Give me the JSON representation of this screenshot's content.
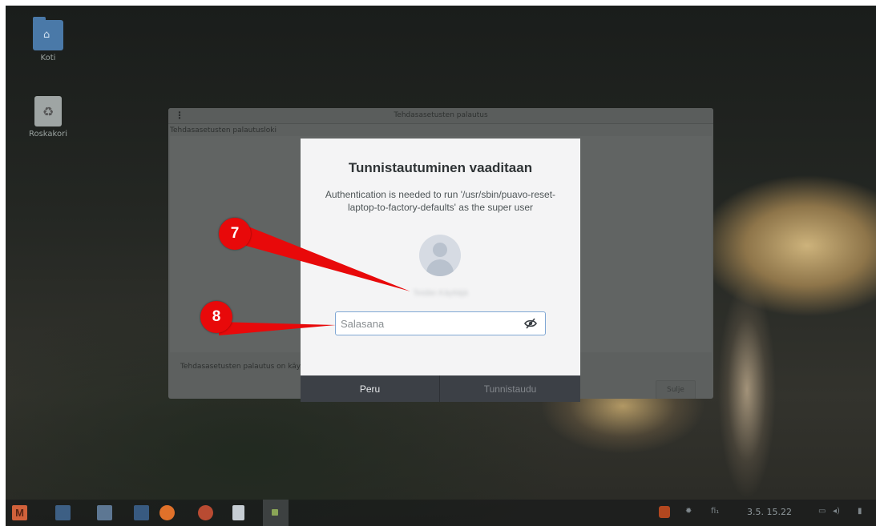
{
  "desktop": {
    "icons": [
      {
        "label": "Koti",
        "icon": "home-folder-icon"
      },
      {
        "label": "Roskakori",
        "icon": "trash-icon"
      }
    ]
  },
  "reset_window": {
    "menu_glyph": "⋮",
    "title": "Tehdasasetusten palautus",
    "log_label": "Tehdasasetusten palautusloki",
    "status_text": "Tehdasasetusten palautus on käy",
    "close_label": "Sulje"
  },
  "auth_dialog": {
    "heading": "Tunnistautuminen vaaditaan",
    "message": "Authentication is needed to run '/usr/sbin/puavo-reset-laptop-to-factory-defaults' as the super user",
    "username": "Teidän Käyttäjä",
    "password_placeholder": "Salasana",
    "password_value": "",
    "cancel_label": "Peru",
    "authenticate_label": "Tunnistaudu"
  },
  "annotations": [
    {
      "number": "7",
      "target": "username"
    },
    {
      "number": "8",
      "target": "password-field"
    }
  ],
  "taskbar": {
    "menu_label": "M",
    "keyboard_layout": "fi₁",
    "clock": "3.5. 15.22"
  },
  "colors": {
    "callout": "#e8090a",
    "dialog_bg": "#f4f4f5",
    "button_bar": "#3c4046"
  }
}
